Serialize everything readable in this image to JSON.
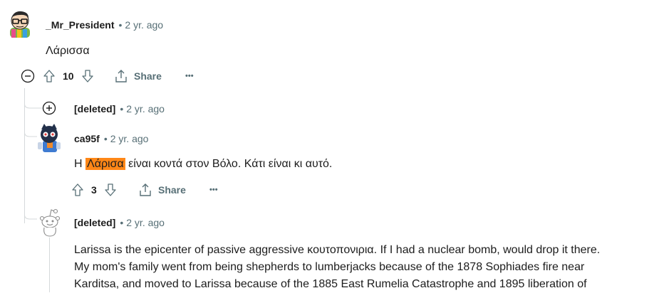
{
  "comments": [
    {
      "username": "_Mr_President",
      "time": "2 yr. ago",
      "body": "Λάρισσα",
      "votes": "10",
      "share_label": "Share",
      "more_label": "•••"
    },
    {
      "username": "[deleted]",
      "time": "2 yr. ago",
      "collapsed": true
    },
    {
      "username": "ca95f",
      "time": "2 yr. ago",
      "body_prefix": "Η ",
      "body_highlight": "Λάρισα",
      "body_suffix": " είναι κοντά στον Βόλο. Κάτι είναι κι αυτό.",
      "votes": "3",
      "share_label": "Share",
      "more_label": "•••"
    },
    {
      "username": "[deleted]",
      "time": "2 yr. ago",
      "body_lines": [
        "Larissa is the epicenter of passive aggressive κουτοπονιρια. If I had a nuclear bomb, would drop it there.",
        "My mom's family went from being shepherds to lumberjacks because of the 1878 Sophiades fire near",
        "Karditsa, and moved to Larissa because of the 1885 East Rumelia Catastrophe and 1895 liberation of"
      ]
    }
  ],
  "colors": {
    "highlight": "#ff8717",
    "meta": "#576f76",
    "thread_line": "#d5d9db"
  }
}
